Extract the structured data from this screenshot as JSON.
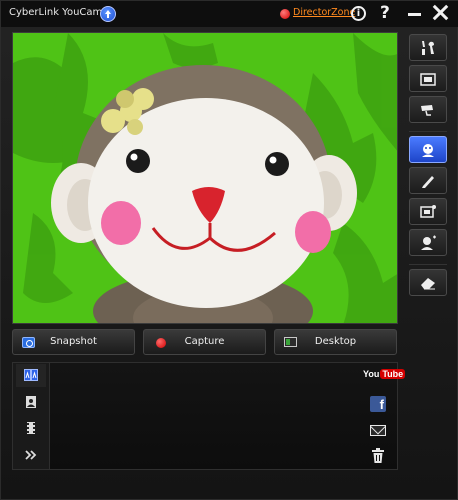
{
  "app": {
    "title": "CyberLink YouCam",
    "director_zone": "DirectorZone"
  },
  "titlebar": {
    "info_glyph": "i",
    "help_glyph": "?"
  },
  "buttons": {
    "snapshot": "Snapshot",
    "capture": "Capture",
    "desktop": "Desktop"
  },
  "sidebar": {
    "items": [
      {
        "icon": "tools-icon"
      },
      {
        "icon": "fullscreen-icon"
      },
      {
        "icon": "surveillance-camera-icon"
      },
      {
        "icon": "effects-avatar-icon",
        "active": true
      },
      {
        "icon": "pencil-icon"
      },
      {
        "icon": "frame-icon"
      },
      {
        "icon": "face-effect-icon"
      },
      {
        "icon": "eraser-icon"
      }
    ]
  },
  "gallery": {
    "tabs": [
      {
        "icon": "all-media-icon",
        "active": true
      },
      {
        "icon": "photo-icon"
      },
      {
        "icon": "video-icon"
      },
      {
        "icon": "expand-arrows-icon"
      }
    ],
    "share": [
      {
        "icon": "youtube-icon",
        "text_you": "You",
        "text_tube": "Tube"
      },
      {
        "icon": "facebook-icon",
        "text": "f"
      },
      {
        "icon": "email-icon"
      },
      {
        "icon": "trash-icon"
      }
    ]
  },
  "colors": {
    "accent_blue": "#2f63e8",
    "background_green": "#4fc316",
    "director_zone_orange": "#ff8a1f"
  }
}
